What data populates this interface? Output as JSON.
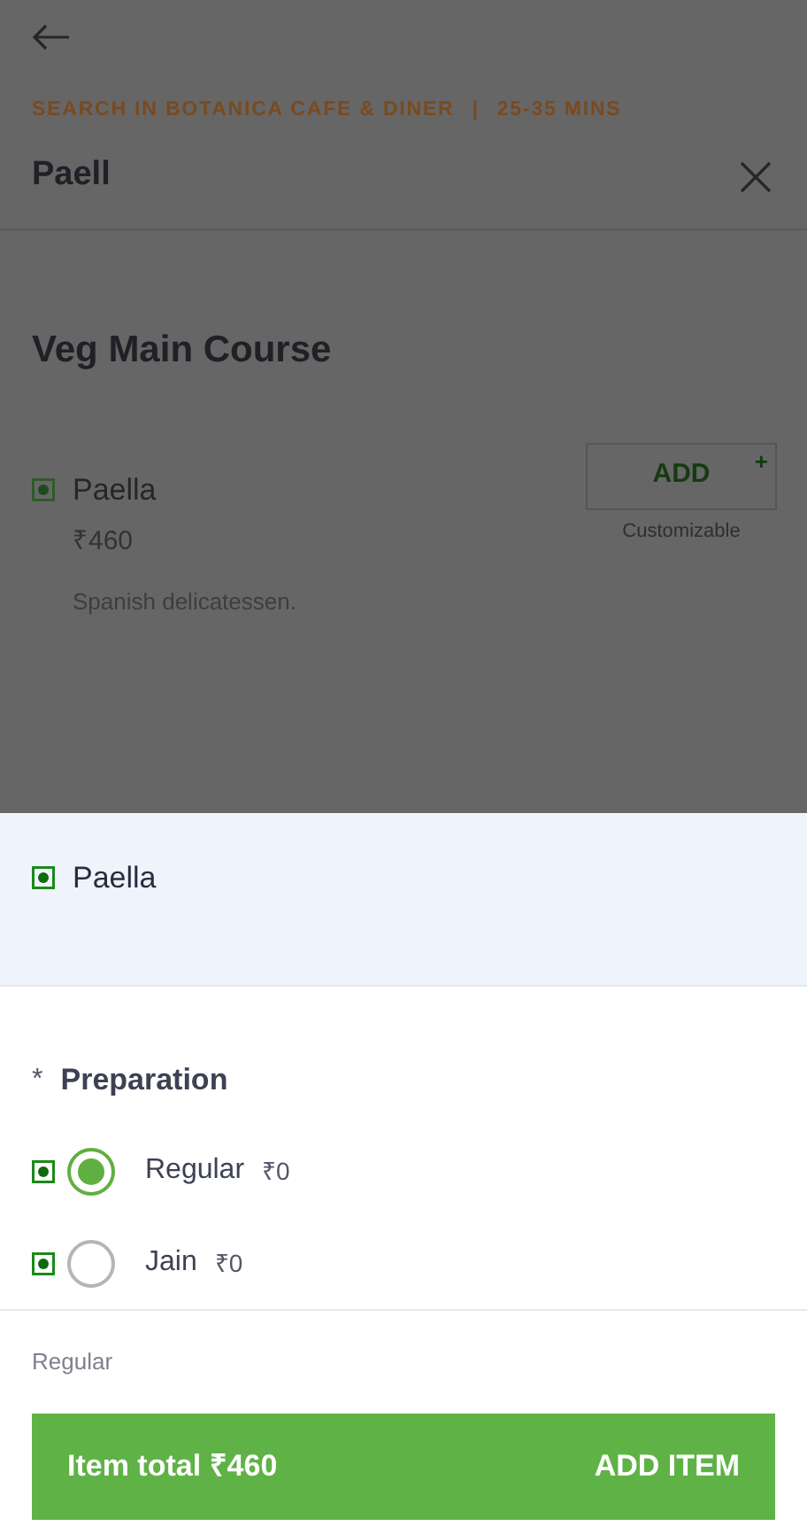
{
  "search_header": {
    "restaurant_line": "SEARCH IN BOTANICA CAFE & DINER",
    "separator": "|",
    "eta": "25-35 MINS",
    "query": "Paell"
  },
  "section": {
    "title": "Veg Main Course"
  },
  "item": {
    "name": "Paella",
    "veg": true,
    "price": "₹460",
    "description": "Spanish delicatessen.",
    "add_label": "ADD",
    "add_plus": "+",
    "note": "Customizable"
  },
  "sheet": {
    "item_name": "Paella",
    "veg": true,
    "group": {
      "required_mark": "*",
      "title": "Preparation",
      "options": [
        {
          "label": "Regular",
          "price": "₹0",
          "veg": true,
          "selected": true
        },
        {
          "label": "Jain",
          "price": "₹0",
          "veg": true,
          "selected": false
        }
      ]
    },
    "summary": "Regular",
    "footer": {
      "total": "Item total ₹460",
      "action": "ADD ITEM"
    }
  }
}
